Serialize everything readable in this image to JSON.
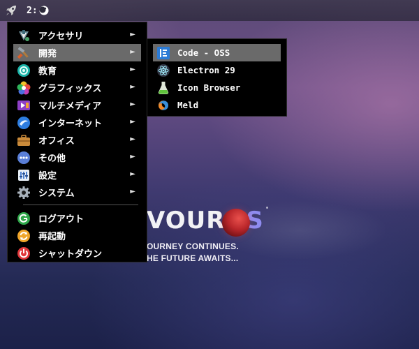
{
  "panel": {
    "launcher_icon": "rocket-icon",
    "workspace_label": "2:",
    "workspace_icon": "firefox-moon-icon"
  },
  "main_menu": {
    "items": [
      {
        "label": "アクセサリ",
        "icon": "accessories-icon",
        "has_submenu": true,
        "active": false
      },
      {
        "label": "開発",
        "icon": "development-icon",
        "has_submenu": true,
        "active": true
      },
      {
        "label": "教育",
        "icon": "education-icon",
        "has_submenu": true,
        "active": false
      },
      {
        "label": "グラフィックス",
        "icon": "graphics-icon",
        "has_submenu": true,
        "active": false
      },
      {
        "label": "マルチメディア",
        "icon": "multimedia-icon",
        "has_submenu": true,
        "active": false
      },
      {
        "label": "インターネット",
        "icon": "internet-icon",
        "has_submenu": true,
        "active": false
      },
      {
        "label": "オフィス",
        "icon": "office-icon",
        "has_submenu": true,
        "active": false
      },
      {
        "label": "その他",
        "icon": "other-icon",
        "has_submenu": true,
        "active": false
      },
      {
        "label": "設定",
        "icon": "settings-icon",
        "has_submenu": true,
        "active": false
      },
      {
        "label": "システム",
        "icon": "system-icon",
        "has_submenu": true,
        "active": false
      }
    ],
    "session_items": [
      {
        "label": "ログアウト",
        "icon": "logout-icon"
      },
      {
        "label": "再起動",
        "icon": "restart-icon"
      },
      {
        "label": "シャットダウン",
        "icon": "shutdown-icon"
      }
    ],
    "arrow_glyph": "►"
  },
  "submenu": {
    "items": [
      {
        "label": "Code - OSS",
        "icon": "code-oss-icon",
        "active": true
      },
      {
        "label": "Electron 29",
        "icon": "electron-icon",
        "active": false
      },
      {
        "label": "Icon Browser",
        "icon": "icon-browser-icon",
        "active": false
      },
      {
        "label": "Meld",
        "icon": "meld-icon",
        "active": false
      }
    ]
  },
  "desktop": {
    "brand_main": "VOUR",
    "brand_accent": "OS",
    "tagline_1": "OURNEY CONTINUES.",
    "tagline_2": "HE FUTURE AWAITS..."
  },
  "colors": {
    "menu_bg": "#000000",
    "highlight": "#6a6a6a",
    "brand_accent": "#8f8cf0",
    "planet": "#c0272b"
  }
}
